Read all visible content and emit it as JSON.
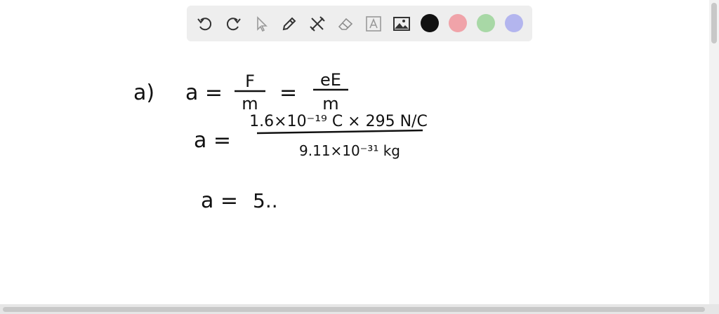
{
  "toolbar": {
    "tools": [
      {
        "name": "undo-icon"
      },
      {
        "name": "redo-icon"
      },
      {
        "name": "select-arrow-icon"
      },
      {
        "name": "pen-icon"
      },
      {
        "name": "tools-icon"
      },
      {
        "name": "eraser-icon"
      },
      {
        "name": "text-box-icon"
      },
      {
        "name": "image-icon"
      }
    ],
    "colors": [
      "#111111",
      "#f0a3a9",
      "#a8d8a6",
      "#b3b5ee"
    ]
  },
  "work": {
    "part_label": "a)",
    "line1": {
      "lhs": "a =",
      "num1": "F",
      "den1": "m",
      "eq": "=",
      "num2": "eE",
      "den2": "m"
    },
    "line2": {
      "lhs": "a =",
      "numerator": "1.6×10⁻¹⁹ C × 295 N/C",
      "denominator": "9.11×10⁻³¹ kg"
    },
    "line3": {
      "lhs": "a =",
      "value": "5.."
    }
  }
}
